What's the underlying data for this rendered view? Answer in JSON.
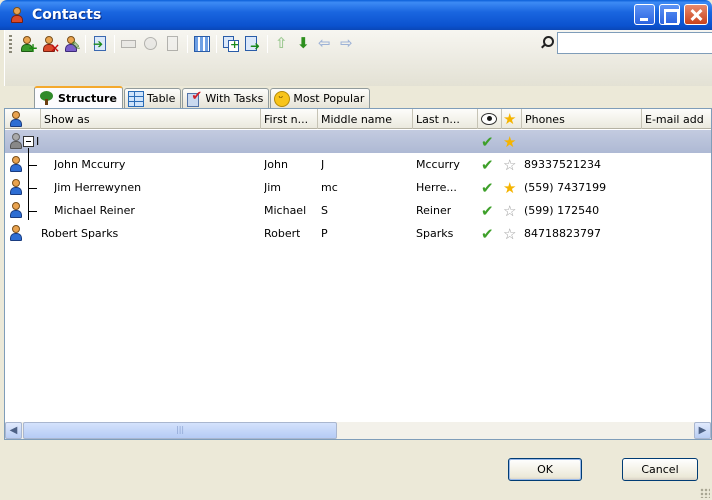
{
  "window": {
    "title": "Contacts"
  },
  "toolbar": {
    "search_value": ""
  },
  "tabs": [
    {
      "label": "Structure",
      "icon": "tree-icon",
      "active": true
    },
    {
      "label": "Table",
      "icon": "table-icon",
      "active": false
    },
    {
      "label": "With Tasks",
      "icon": "tasks-icon",
      "active": false
    },
    {
      "label": "Most Popular",
      "icon": "smile-icon",
      "active": false
    }
  ],
  "columns": {
    "show_as": "Show as",
    "first_name": "First n...",
    "middle_name": "Middle name",
    "last_name": "Last n...",
    "phones": "Phones",
    "email": "E-mail add"
  },
  "group": {
    "label": "I"
  },
  "rows": [
    {
      "show_as": "John Mccurry",
      "first": "John",
      "middle": "J",
      "last": "Mccurry",
      "phone": "89337521234",
      "favorite": false
    },
    {
      "show_as": "Jim Herrewynen",
      "first": "Jim",
      "middle": "mc",
      "last": "Herre...",
      "phone": "(559) 7437199",
      "favorite": true
    },
    {
      "show_as": "Michael Reiner",
      "first": "Michael",
      "middle": "S",
      "last": "Reiner",
      "phone": "(599) 172540",
      "favorite": false
    },
    {
      "show_as": "Robert Sparks",
      "first": "Robert",
      "middle": "P",
      "last": "Sparks",
      "phone": "84718823797",
      "favorite": false
    }
  ],
  "buttons": {
    "ok": "OK",
    "cancel": "Cancel"
  },
  "colors": {
    "titlebar": "#0b52cf",
    "group_row": "#b5c0d8",
    "check": "#3ea02a",
    "star_gold": "#f5b400"
  }
}
